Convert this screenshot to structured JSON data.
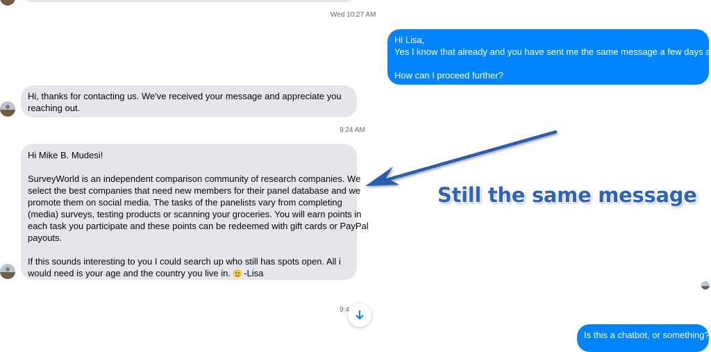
{
  "timestamps": {
    "t1": "Wed 10:27 AM",
    "t2": "9:24 AM",
    "t3": "9:4"
  },
  "messages": {
    "sent1": {
      "lines": [
        "Hi Lisa,",
        "Yes I know that already and you have sent me the same message a few days ago.",
        "How can I proceed further?"
      ]
    },
    "recv1": {
      "lines": [
        "Hi, thanks for contacting us. We've received your message and appreciate you",
        "reaching out."
      ]
    },
    "recv2": {
      "greeting": "Hi Mike B. Mudesi!",
      "p1": [
        "SurveyWorld is an independent comparison community of research companies. We",
        "select the best companies that need new members for their panel database and we",
        "promote them on social media. The tasks of the panelists vary from completing",
        "(media) surveys, testing products or scanning your groceries. You will earn points in",
        "each task you participate and these points can be redeemed with gift cards or PayPal",
        "payouts."
      ],
      "p2": [
        "If this sounds interesting to you I could search up who still has spots open. All i",
        "would need is your age and the country you live in."
      ],
      "emoji": "smiling-face-emoji",
      "signoff": " -Lisa"
    },
    "sent2": {
      "text": "Is this a chatbot, or something?"
    }
  },
  "annotation": {
    "text": "Still the same message",
    "color": "#2f63b8"
  },
  "colors": {
    "sent_bubble": "#0084ff",
    "received_bubble": "#e4e6eb",
    "timestamp": "#65676b"
  },
  "icons": {
    "scroll": "arrow-down-icon"
  }
}
